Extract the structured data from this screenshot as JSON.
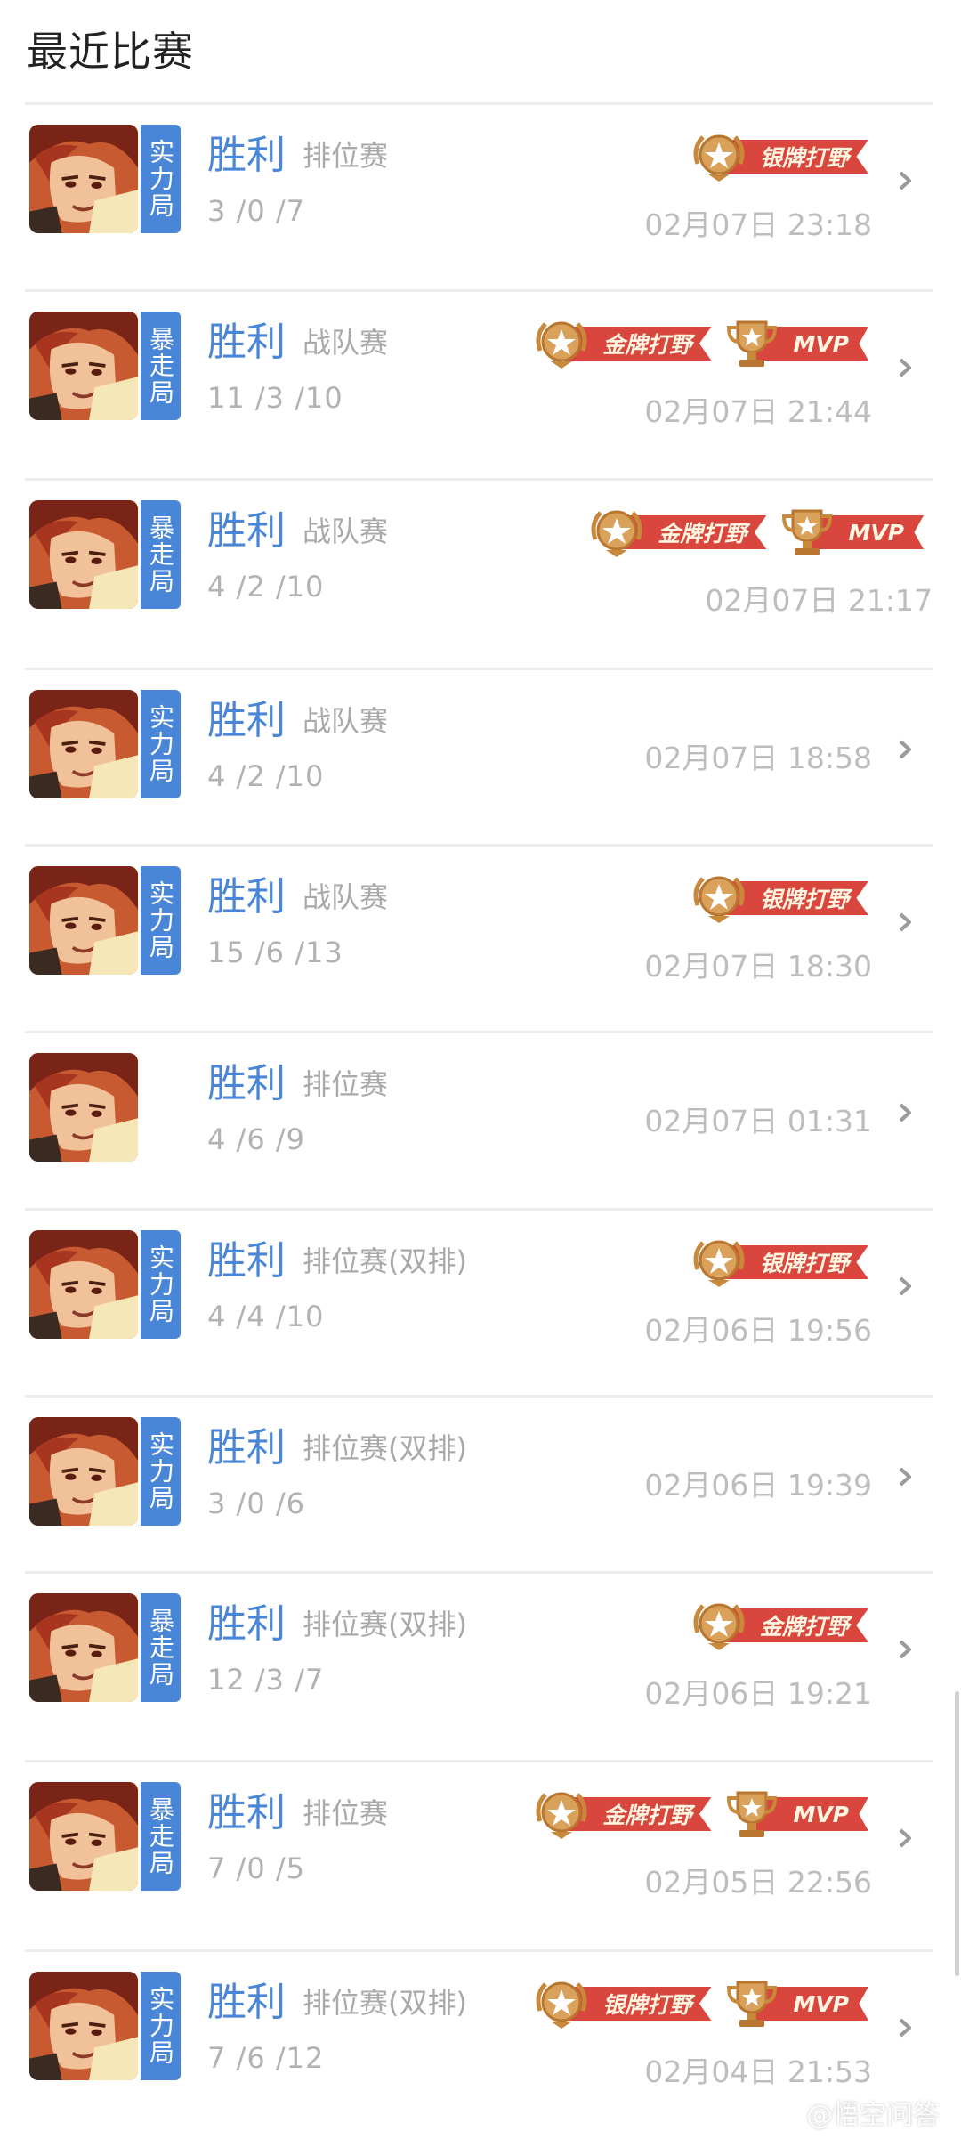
{
  "header": {
    "title": "最近比赛"
  },
  "colors": {
    "accent": "#4a86d8",
    "ribbon": "#d9463d",
    "medal": "#c8893b"
  },
  "matches": [
    {
      "mode": "实力局",
      "result": "胜利",
      "type": "排位赛",
      "kda": "3 /0 /7",
      "time": "02月07日 23:18",
      "badges": [
        {
          "label": "银牌打野",
          "icon": "star-medal-icon"
        }
      ]
    },
    {
      "mode": "暴走局",
      "result": "胜利",
      "type": "战队赛",
      "kda": "11 /3 /10",
      "time": "02月07日 21:44",
      "badges": [
        {
          "label": "金牌打野",
          "icon": "star-medal-icon"
        },
        {
          "label": "MVP",
          "icon": "trophy-icon"
        }
      ]
    },
    {
      "mode": "暴走局",
      "result": "胜利",
      "type": "战队赛",
      "kda": "4 /2 /10",
      "time": "02月07日 21:17",
      "badges": [
        {
          "label": "金牌打野",
          "icon": "star-medal-icon"
        },
        {
          "label": "MVP",
          "icon": "trophy-icon"
        }
      ]
    },
    {
      "mode": "实力局",
      "result": "胜利",
      "type": "战队赛",
      "kda": "4 /2 /10",
      "time": "02月07日 18:58",
      "badges": []
    },
    {
      "mode": "实力局",
      "result": "胜利",
      "type": "战队赛",
      "kda": "15 /6 /13",
      "time": "02月07日 18:30",
      "badges": [
        {
          "label": "银牌打野",
          "icon": "star-medal-icon"
        }
      ]
    },
    {
      "mode": "",
      "result": "胜利",
      "type": "排位赛",
      "kda": "4 /6 /9",
      "time": "02月07日 01:31",
      "badges": []
    },
    {
      "mode": "实力局",
      "result": "胜利",
      "type": "排位赛(双排)",
      "kda": "4 /4 /10",
      "time": "02月06日 19:56",
      "badges": [
        {
          "label": "银牌打野",
          "icon": "star-medal-icon"
        }
      ]
    },
    {
      "mode": "实力局",
      "result": "胜利",
      "type": "排位赛(双排)",
      "kda": "3 /0 /6",
      "time": "02月06日 19:39",
      "badges": []
    },
    {
      "mode": "暴走局",
      "result": "胜利",
      "type": "排位赛(双排)",
      "kda": "12 /3 /7",
      "time": "02月06日 19:21",
      "badges": [
        {
          "label": "金牌打野",
          "icon": "star-medal-icon"
        }
      ]
    },
    {
      "mode": "暴走局",
      "result": "胜利",
      "type": "排位赛",
      "kda": "7 /0 /5",
      "time": "02月05日 22:56",
      "badges": [
        {
          "label": "金牌打野",
          "icon": "star-medal-icon"
        },
        {
          "label": "MVP",
          "icon": "trophy-icon"
        }
      ]
    },
    {
      "mode": "实力局",
      "result": "胜利",
      "type": "排位赛(双排)",
      "kda": "7 /6 /12",
      "time": "02月04日 21:53",
      "badges": [
        {
          "label": "银牌打野",
          "icon": "star-medal-icon"
        },
        {
          "label": "MVP",
          "icon": "trophy-icon"
        }
      ]
    }
  ],
  "watermark": "@悟空问答"
}
